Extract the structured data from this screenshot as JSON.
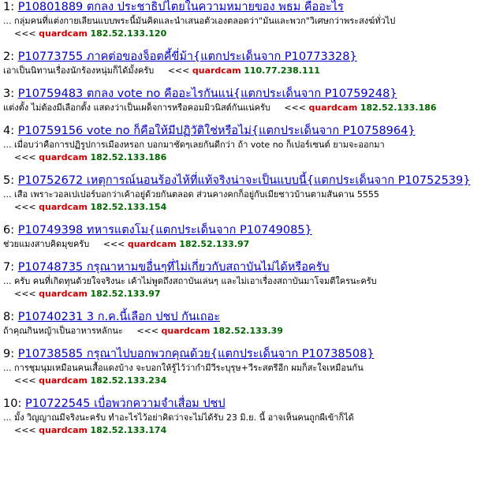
{
  "items": [
    {
      "num": "1:",
      "title": "P10801889 ตกลง ประชาธิปไตยในความหมายของ พธม คืออะไร",
      "snippet": "... กลุ่มคนที่แต่งกายเลียนแบบพระนี้มันคิดและนำเสนอตัวเองตลอดว่า\"มันและพวก\"วิเศษกว่าพระสงฆ์ทั่วไป",
      "arrows": "<<<",
      "user": "quardcam",
      "ip": "182.52.133.120",
      "inline": false
    },
    {
      "num": "2:",
      "title": "P10773755 ภาคต่อของจ็อตคี้ขี่ม้า{แตกประเด็นจาก P10773328}",
      "snippet": "เอาเป็นนิทานเรื่องนักร้องหนุ่มก็ได้มั้งครับ",
      "arrows": "<<<",
      "user": "quardcam",
      "ip": "110.77.238.111",
      "inline": true
    },
    {
      "num": "3:",
      "title": "P10759483 ตกลง vote no คืออะไรกันแน่{แตกประเด็นจาก P10759248}",
      "snippet": "แต่งตั้ง ไม่ต้องมีเลือกตั้ง แสดงว่าเป็นเผด็จการหรือคอมมิวนิสต์กันแน่ครับ",
      "arrows": "<<<",
      "user": "quardcam",
      "ip": "182.52.133.186",
      "inline": true
    },
    {
      "num": "4:",
      "title": "P10759156 vote no ก็คือให้มีปฏิวัติใช่หรือไม่{แตกประเด็นจาก P10758964}",
      "snippet": "... เมื่อบว่าคือการปฏิรูปการเมืองหรอก บอกมาชัดๆเลยกันดีกว่า ถ้า vote no ก็เปอร์เซนต์ ยามจะออกมา",
      "arrows": "<<<",
      "user": "quardcam",
      "ip": "182.52.133.186",
      "inline": false
    },
    {
      "num": "5:",
      "title": "P10752672 เหตุการณ์นอนร้องไห้ที่แท้จริงน่าจะเป็นแบบนี้{แตกประเด็นจาก P10752539}",
      "snippet": "... เสือ เพราะวอลเปเปอร์บอกว่าเค้าอยู่ด้วยกันตลอด ส่วนคางคกก็อยู่กับเมียชาวบ้านตามสันดาน 5555",
      "arrows": "<<<",
      "user": "quardcam",
      "ip": "182.52.133.154",
      "inline": false
    },
    {
      "num": "6:",
      "title": "P10749398 ทหารแตงโม{แตกประเด็นจาก P10749085}",
      "snippet": "ช่วยแมงสาบคิดมุขครับ",
      "arrows": "<<<",
      "user": "quardcam",
      "ip": "182.52.133.97",
      "inline": true
    },
    {
      "num": "7:",
      "title": "P10748735 กรุณาหามขอื่นๆที่ไม่เกี่ยวกับสถาบันไม่ได้หรือครับ",
      "snippet": "... ครับ คนที่เกิดทุนด้วยใจจริงนะ เค้าไม่พูดถึงสถาบันเล่นๆ และไม่เอาเรื่องสถาบันมาโจมตีใครนะครับ",
      "arrows": "<<<",
      "user": "quardcam",
      "ip": "182.52.133.97",
      "inline": false
    },
    {
      "num": "8:",
      "title": "P10740231 3 ก.ค.นี้เลือก ปชป กันเถอะ",
      "snippet": "ถ้าคุณกินหญ้าเป็นอาหารหลักนะ",
      "arrows": "<<<",
      "user": "quardcam",
      "ip": "182.52.133.39",
      "inline": true
    },
    {
      "num": "9:",
      "title": "P10738585 กรุณาไปบอกพวกคุณด้วย{แตกประเด็นจาก P10738508}",
      "snippet": "... การชุมนุมเหมือนคนเสื้อแดงบ้าง จะบอกให้รู้ไว้ว่ากำมีวีระบุรุษ+วีระสตรีอีก ผมก็สะใจเหมือนกัน",
      "arrows": "<<<",
      "user": "quardcam",
      "ip": "182.52.133.234",
      "inline": false
    },
    {
      "num": "10:",
      "title": "P10722545 เบื่อพวกความจำเสื่อม ปชป",
      "snippet": "... มั้ง วิญญาณมีจริงนะครับ ทำอะไรไว้อย่าคิดว่าจะไม่ได้รับ 23 มิ.ย. นี้ อาจเห็นคนถูกผีเข้าก็ได้",
      "arrows": "<<<",
      "user": "quardcam",
      "ip": "182.52.133.174",
      "inline": false
    }
  ]
}
